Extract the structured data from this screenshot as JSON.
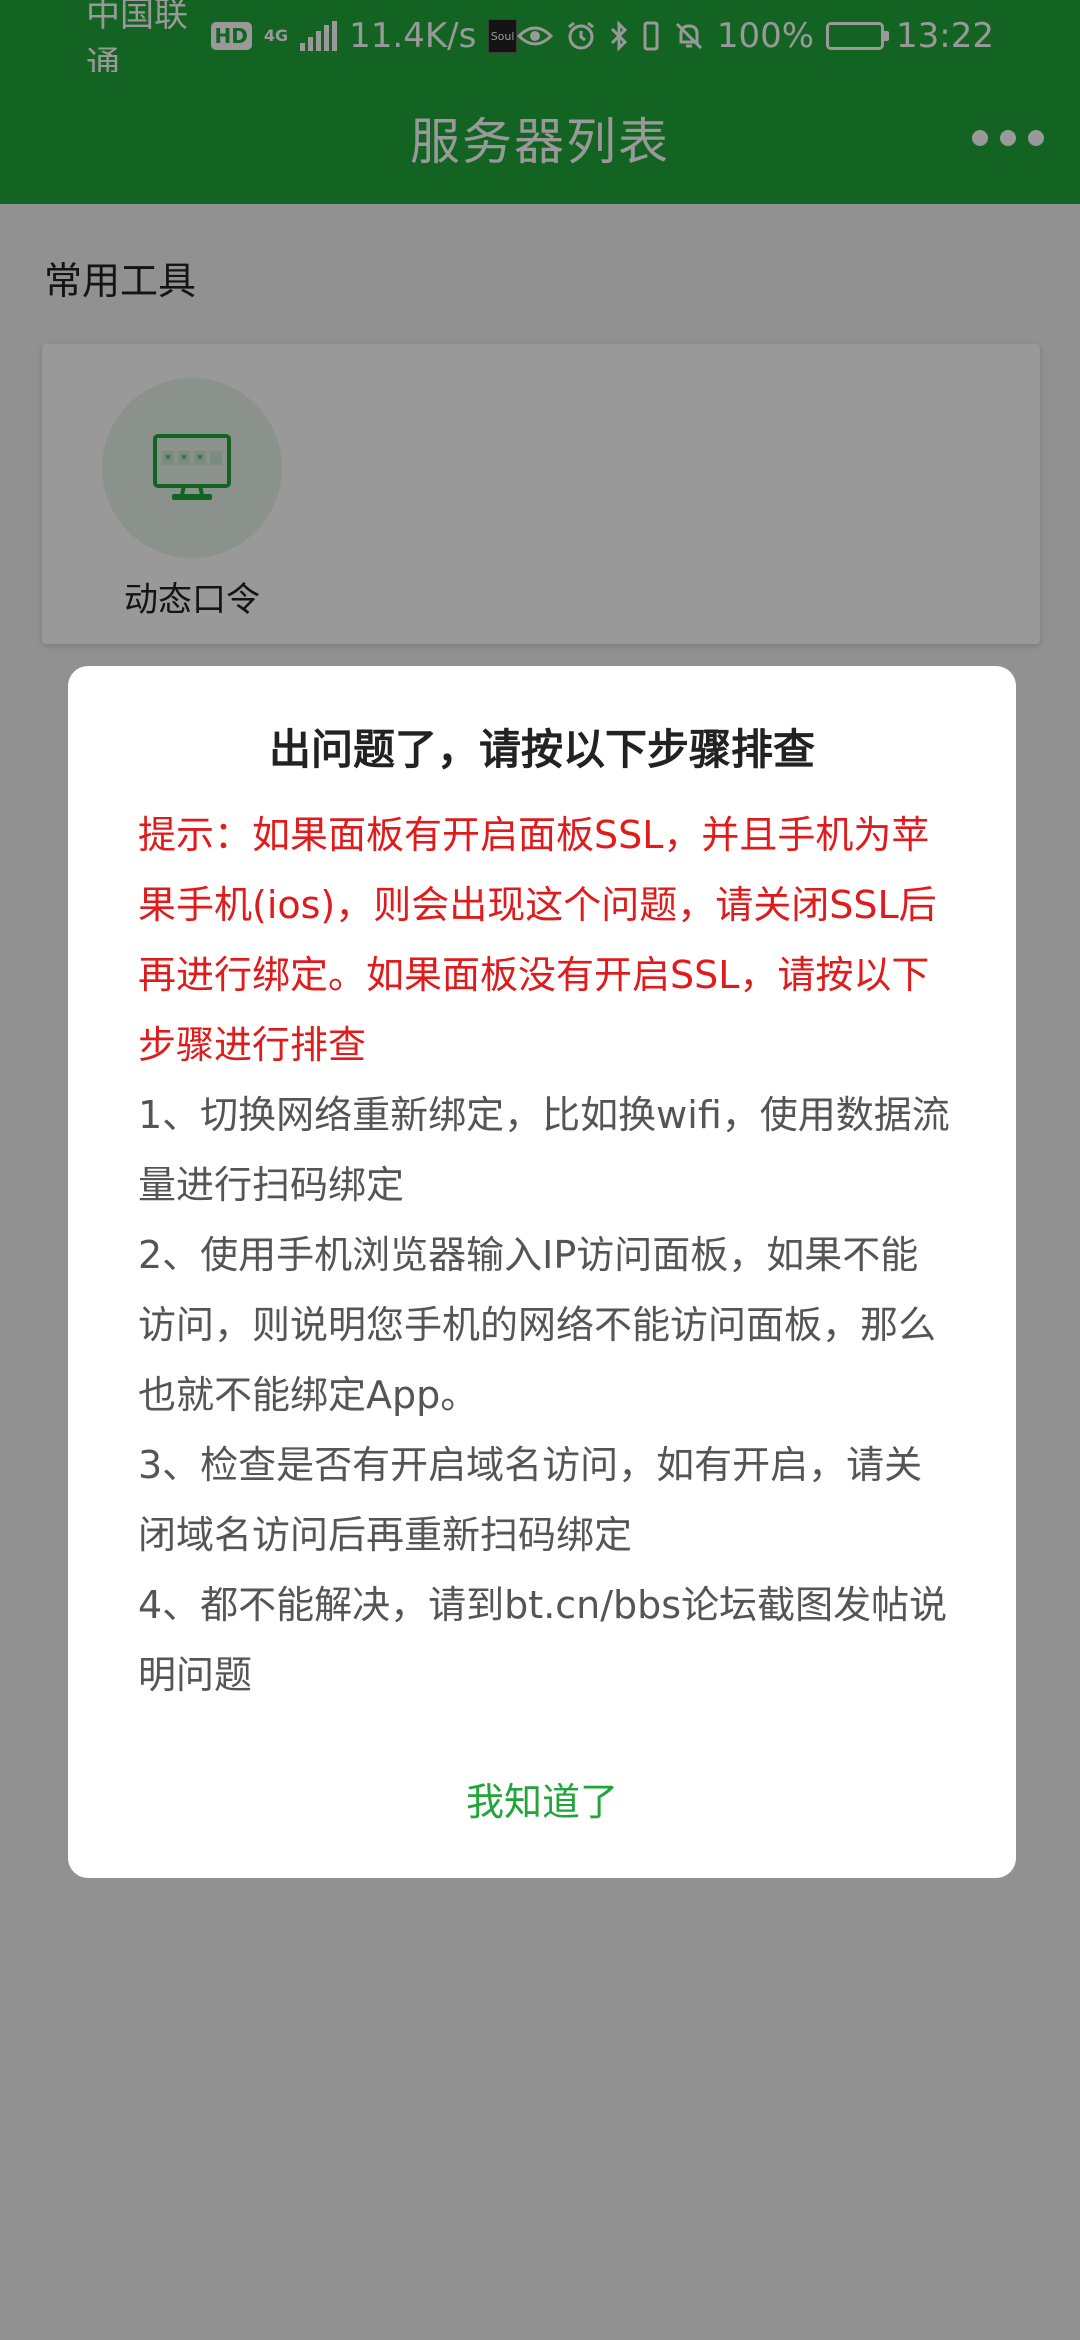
{
  "status_bar": {
    "carrier": "中国联通",
    "hd_badge": "HD",
    "network_type": "4G",
    "net_speed": "11.4K/s",
    "soul_app_label": "Soul",
    "battery_percent": "100%",
    "time": "13:22",
    "icons": [
      "eye-icon",
      "alarm-icon",
      "bluetooth-icon",
      "vibrate-icon",
      "mute-icon",
      "battery-icon"
    ]
  },
  "app_bar": {
    "title": "服务器列表",
    "more_icon": "more-dots-icon"
  },
  "tools": {
    "section_title": "常用工具",
    "items": [
      {
        "label": "动态口令",
        "icon": "dynamic-token-monitor-icon"
      }
    ]
  },
  "dialog": {
    "title": "出问题了，请按以下步骤排查",
    "warning": "提示：如果面板有开启面板SSL，并且手机为苹果手机(ios)，则会出现这个问题，请关闭SSL后再进行绑定。如果面板没有开启SSL，请按以下步骤进行排查",
    "steps": [
      "1、切换网络重新绑定，比如换wifi，使用数据流量进行扫码绑定",
      "2、使用手机浏览器输入IP访问面板，如果不能访问，则说明您手机的网络不能访问面板，那么也就不能绑定App。",
      "3、检查是否有开启域名访问，如有开启，请关闭域名访问后再重新扫码绑定",
      "4、都不能解决，请到bt.cn/bbs论坛截图发帖说明问题"
    ],
    "confirm_label": "我知道了"
  },
  "colors": {
    "brand_green": "#20a53a",
    "warning_red": "#e01b1b",
    "body_text": "#555555"
  }
}
